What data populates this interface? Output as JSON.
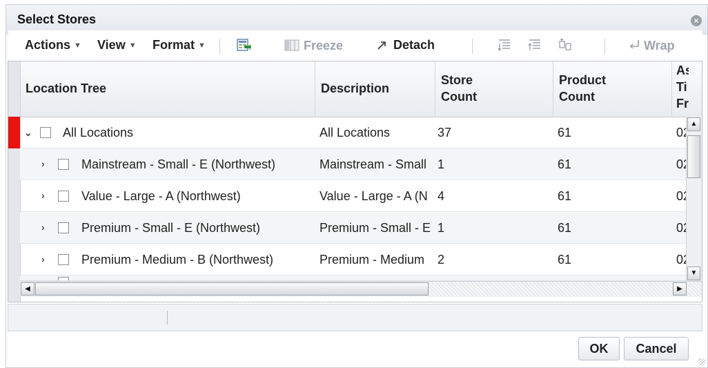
{
  "dialog": {
    "title": "Select Stores"
  },
  "toolbar": {
    "actions": "Actions",
    "view": "View",
    "format": "Format",
    "freeze": "Freeze",
    "detach": "Detach",
    "wrap": "Wrap"
  },
  "grid": {
    "headers": {
      "location_tree": "Location Tree",
      "description": "Description",
      "store_count_1": "Store",
      "store_count_2": "Count",
      "product_count_1": "Product",
      "product_count_2": "Count",
      "extra_1": "As",
      "extra_2": "Ti",
      "extra_3": "Fr"
    },
    "rows": [
      {
        "name": "All Locations",
        "description": "All Locations",
        "store_count": "37",
        "product_count": "61",
        "extra": "02"
      },
      {
        "name": "Mainstream - Small - E (Northwest)",
        "description": "Mainstream - Small",
        "store_count": "1",
        "product_count": "61",
        "extra": "02"
      },
      {
        "name": "Value - Large - A (Northwest)",
        "description": "Value - Large - A (N",
        "store_count": "4",
        "product_count": "61",
        "extra": "02"
      },
      {
        "name": "Premium - Small - E (Northwest)",
        "description": "Premium - Small - E",
        "store_count": "1",
        "product_count": "61",
        "extra": "02"
      },
      {
        "name": "Premium - Medium - B (Northwest)",
        "description": "Premium - Medium",
        "store_count": "2",
        "product_count": "61",
        "extra": "02"
      }
    ]
  },
  "buttons": {
    "ok": "OK",
    "cancel": "Cancel"
  },
  "colors": {
    "selected_row_marker": "#e8130f"
  },
  "icons": {
    "close": "close-icon",
    "export": "export-to-excel-icon",
    "freeze": "freeze-icon",
    "detach": "detach-icon",
    "wrap": "wrap-icon"
  }
}
